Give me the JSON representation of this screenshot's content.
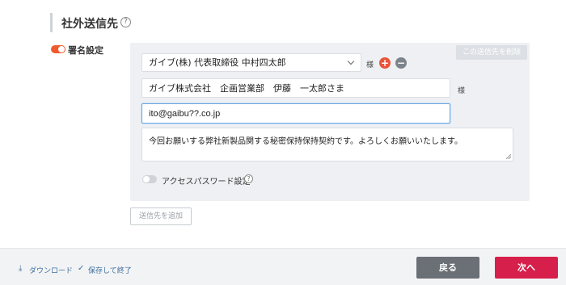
{
  "section": {
    "title": "社外送信先"
  },
  "signature": {
    "label": "署名設定",
    "enabled": true
  },
  "recipient": {
    "delete_label": "この送信先を削除",
    "selected_name": "ガイブ(株) 代表取締役 中村四太郎",
    "name_suffix": "様",
    "company_name": "ガイブ株式会社　企画営業部　伊藤　一太郎さま",
    "company_suffix": "様",
    "email": "ito@gaibu??.co.jp",
    "message": "今回お願いする弊社新製品関する秘密保持保持契約です。よろしくお願いいたします。",
    "access_password_label": "アクセスパスワード設定",
    "access_password_enabled": false
  },
  "add_recipient_label": "送信先を追加",
  "footer": {
    "download_label": "ダウンロード",
    "save_exit_label": "保存して終了",
    "back_label": "戻る",
    "next_label": "次へ"
  },
  "colors": {
    "accent": "#f15a2b",
    "next": "#d71f4b",
    "back": "#6a7076",
    "link": "#3d6f9e"
  }
}
